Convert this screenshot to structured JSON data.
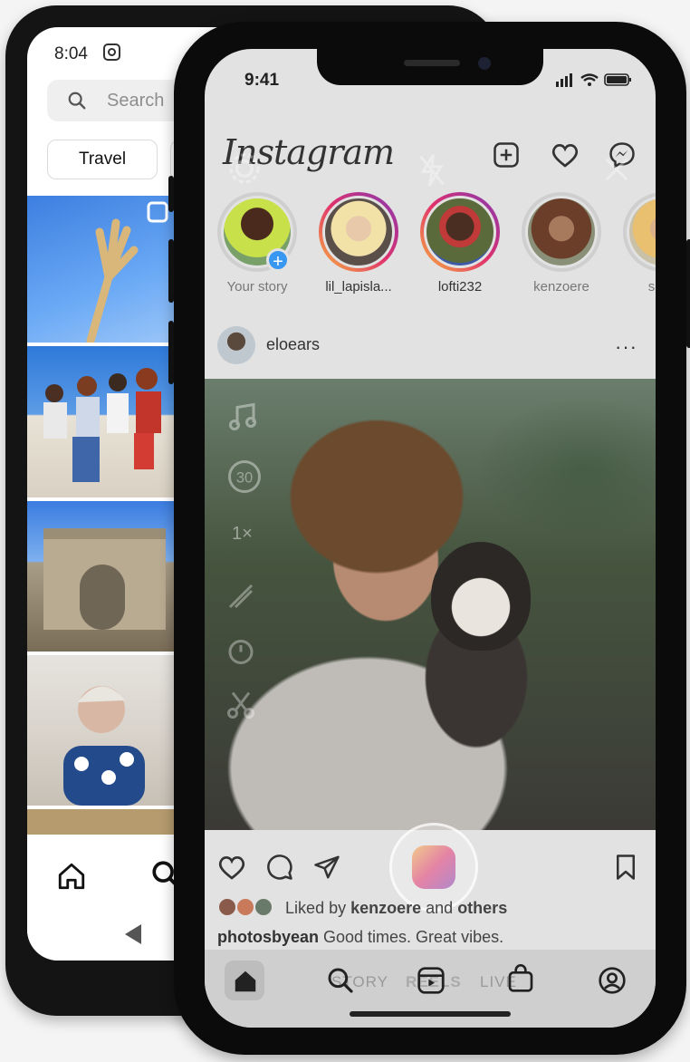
{
  "android": {
    "time": "8:04",
    "search_placeholder": "Search",
    "chip_label": "Travel"
  },
  "iphone": {
    "time": "9:41",
    "logo": "Instagram",
    "stories": [
      {
        "name": "Your story"
      },
      {
        "name": "lil_lapisla..."
      },
      {
        "name": "lofti232"
      },
      {
        "name": "kenzoere"
      },
      {
        "name": "sapp"
      }
    ],
    "post": {
      "username": "eloears",
      "more": "···",
      "liked_prefix": "Liked by ",
      "liked_user": "kenzoere",
      "liked_and": " and ",
      "liked_others": "others",
      "caption_user": "photosbyean",
      "caption_text": " Good times. Great vibes."
    },
    "camera_modes": [
      "STORY",
      "REELS",
      "LIVE"
    ],
    "camera_tools": [
      "30",
      "1×"
    ]
  },
  "colors": {
    "gradient_start": "#f7b23e",
    "gradient_mid": "#e1306c",
    "gradient_end": "#833ab4",
    "add_story_blue": "#3897f0"
  }
}
